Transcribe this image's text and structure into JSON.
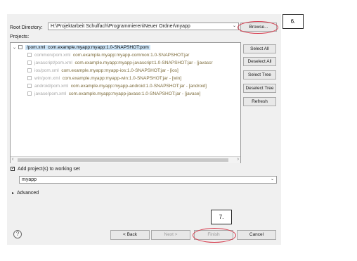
{
  "root_directory": {
    "label": "Root Directory:",
    "value": "H:\\Projektarbeit Schulfach\\Programmieren\\Neuer Ordner\\myapp",
    "browse_label": "Browse..."
  },
  "projects": {
    "label": "Projects:",
    "root_item": {
      "path": "/pom.xml",
      "coords": "com.example.myapp:myapp:1.0-SNAPSHOT:pom"
    },
    "children": [
      {
        "path": "common/pom.xml",
        "coords": "com.example.myapp:myapp-common:1.0-SNAPSHOT:jar"
      },
      {
        "path": "javascript/pom.xml",
        "coords": "com.example.myapp:myapp-javascript:1.0-SNAPSHOT:jar - [javascr"
      },
      {
        "path": "ios/pom.xml",
        "coords": "com.example.myapp:myapp-ios:1.0-SNAPSHOT:jar - [ios]"
      },
      {
        "path": "win/pom.xml",
        "coords": "com.example.myapp:myapp-win:1.0-SNAPSHOT:jar - [win]"
      },
      {
        "path": "android/pom.xml",
        "coords": "com.example.myapp:myapp-android:1.0-SNAPSHOT:jar - [android]"
      },
      {
        "path": "javase/pom.xml",
        "coords": "com.example.myapp:myapp-javase:1.0-SNAPSHOT:jar - [javase]"
      }
    ],
    "buttons": {
      "select_all": "Select All",
      "deselect_all": "Deselect All",
      "select_tree": "Select Tree",
      "deselect_tree": "Deselect Tree",
      "refresh": "Refresh"
    }
  },
  "working_set": {
    "checkbox_label": "Add project(s) to working set",
    "value": "myapp"
  },
  "advanced": {
    "label": "Advanced"
  },
  "footer": {
    "back": "< Back",
    "next": "Next >",
    "finish": "Finish",
    "cancel": "Cancel"
  },
  "annotations": {
    "step6": "6.",
    "step7": "7.",
    "color": "#d6394b"
  },
  "icons": {
    "help": "help-icon",
    "tree_expand": "chevron-down-icon",
    "advanced_expand": "chevron-right-icon",
    "combo": "chevron-down-icon"
  }
}
